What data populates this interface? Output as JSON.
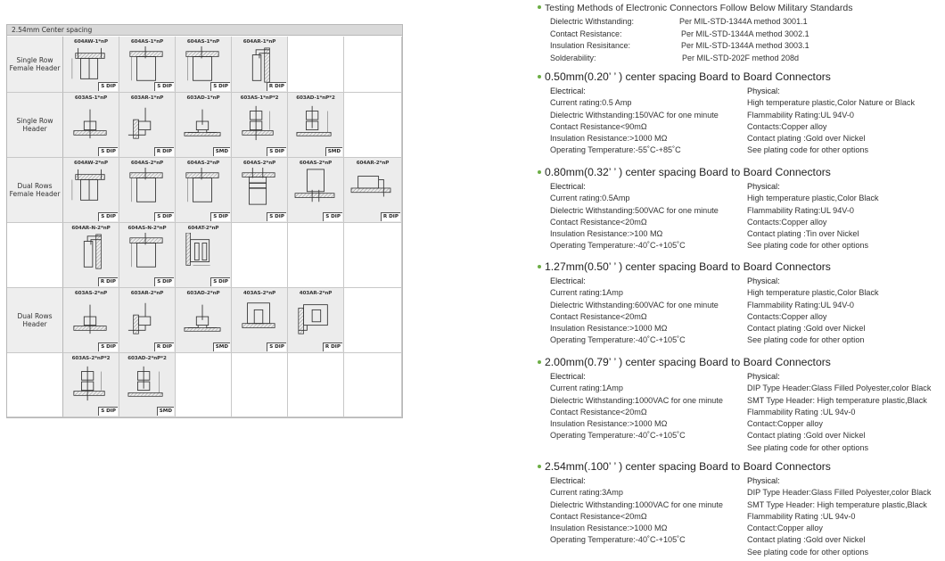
{
  "catalog": {
    "header": "2.54mm Center spacing",
    "rows": [
      {
        "label": "Single Row Female Header",
        "label_lines": [
          "Single Row",
          "Female Header"
        ],
        "cells": [
          {
            "part": "604AW-1*nP",
            "type": "S DIP",
            "icon": "female-header-wide-drawing"
          },
          {
            "part": "604AS-1*nP",
            "type": "S DIP",
            "icon": "female-header-straight-drawing"
          },
          {
            "part": "604AS-1*nP",
            "type": "S DIP",
            "icon": "female-header-straight-drawing"
          },
          {
            "part": "604AR-1*nP",
            "type": "R DIP",
            "icon": "female-header-right-angle-drawing"
          },
          null,
          null
        ]
      },
      {
        "label": "Single Row Header",
        "label_lines": [
          "Single Row",
          "Header"
        ],
        "cells": [
          {
            "part": "603AS-1*nP",
            "type": "S DIP",
            "icon": "pin-header-straight-drawing"
          },
          {
            "part": "603AR-1*nP",
            "type": "R DIP",
            "icon": "pin-header-right-angle-drawing"
          },
          {
            "part": "603AD-1*nP",
            "type": "SMD",
            "icon": "pin-header-smd-drawing"
          },
          {
            "part": "603AS-1*nP*2",
            "type": "S DIP",
            "icon": "pin-header-double-straight-drawing"
          },
          {
            "part": "603AD-1*nP*2",
            "type": "SMD",
            "icon": "pin-header-double-smd-drawing"
          },
          null
        ]
      },
      {
        "label": "Dual Rows Female Header",
        "label_lines": [
          "Dual Rows",
          "Female Header"
        ],
        "cells": [
          {
            "part": "604AW-2*nP",
            "type": "S DIP",
            "icon": "female-header-wide-drawing"
          },
          {
            "part": "604AS-2*nP",
            "type": "S DIP",
            "icon": "female-header-straight-drawing"
          },
          {
            "part": "604AS-2*nP",
            "type": "S DIP",
            "icon": "female-header-straight-drawing"
          },
          {
            "part": "604AS-2*nP",
            "type": "S DIP",
            "icon": "female-header-tall-drawing"
          },
          {
            "part": "604AS-2*nP",
            "type": "S DIP",
            "icon": "female-header-bottom-drawing"
          },
          {
            "part": "604AR-2*nP",
            "type": "R DIP",
            "icon": "female-header-right-angle-flat-drawing"
          }
        ]
      },
      {
        "label": "",
        "label_lines": [],
        "cells": [
          {
            "part": "604AR-N-2*nP",
            "type": "R DIP",
            "icon": "female-header-right-angle-drawing"
          },
          {
            "part": "604AS-N-2*nP",
            "type": "S DIP",
            "icon": "female-header-straight-drawing"
          },
          {
            "part": "604AT-2*nP",
            "type": "S DIP",
            "icon": "female-header-side-entry-drawing"
          },
          null,
          null,
          null
        ]
      },
      {
        "label": "Dual Rows Header",
        "label_lines": [
          "Dual Rows",
          "Header"
        ],
        "cells": [
          {
            "part": "603AS-2*nP",
            "type": "S DIP",
            "icon": "pin-header-straight-drawing"
          },
          {
            "part": "603AR-2*nP",
            "type": "R DIP",
            "icon": "pin-header-right-angle-drawing"
          },
          {
            "part": "603AD-2*nP",
            "type": "SMD",
            "icon": "pin-header-smd-drawing"
          },
          {
            "part": "403AS-2*nP",
            "type": "S DIP",
            "icon": "box-header-straight-drawing"
          },
          {
            "part": "403AR-2*nP",
            "type": "R DIP",
            "icon": "box-header-right-angle-drawing"
          },
          null
        ]
      },
      {
        "label": "",
        "label_lines": [],
        "cells": [
          {
            "part": "603AS-2*nP*2",
            "type": "S DIP",
            "icon": "pin-header-double-straight-drawing"
          },
          {
            "part": "603AD-2*nP*2",
            "type": "SMD",
            "icon": "pin-header-double-smd-drawing"
          },
          null,
          null,
          null,
          null
        ]
      }
    ]
  },
  "military": {
    "title": "Testing Methods of Electronic Connectors Follow Below Military Standards",
    "rows": [
      {
        "label": "Dielectric Withstanding:",
        "value": "Per MIL-STD-1344A method 3001.1"
      },
      {
        "label": "Contact  Resistance:",
        "value": "Per MIL-STD-1344A method 3002.1"
      },
      {
        "label": "Insulation Resisitance:",
        "value": "Per MIL-STD-1344A method 3003.1"
      },
      {
        "label": "Solderability:",
        "value": "Per MIL-STD-202F method 208d"
      }
    ]
  },
  "sections": [
    {
      "title": "0.50mm(0.20’ ’ ) center spacing Board to Board Connectors",
      "electrical_head": "Electrical:",
      "electrical": [
        "Current rating:0.5 Amp",
        "Dielectric Withstanding:150VAC for one minute",
        "Contact Resistance<90mΩ",
        "Insulation Resistance:>1000 MΩ",
        "Operating  Temperature:-55˚C-+85˚C"
      ],
      "physical_head": "Physical:",
      "physical": [
        "High temperature plastic,Color Nature or Black",
        "Flammability Rating:UL 94V-0",
        "Contacts:Copper alloy",
        "Contact plating :Gold over Nickel",
        "See plating code for other options"
      ]
    },
    {
      "title": "0.80mm(0.32’ ’ ) center spacing Board to Board Connectors",
      "electrical_head": "Electrical:",
      "electrical": [
        "Current rating:0.5Amp",
        "Dielectric Withstanding:500VAC for one minute",
        "Contact Resistance<20mΩ",
        "Insulation Resistance:>100 MΩ",
        "Operating  Temperature:-40˚C-+105˚C"
      ],
      "physical_head": "Physical:",
      "physical": [
        "High temperature plastic,Color Black",
        "Flammability Rating:UL 94V-0",
        "Contacts:Copper alloy",
        "Contact plating :Tin over Nickel",
        "See plating code for other options"
      ]
    },
    {
      "title": "1.27mm(0.50’ ’ ) center spacing Board to Board Connectors",
      "electrical_head": "Electrical:",
      "electrical": [
        "Current rating:1Amp",
        "Dielectric Withstanding:600VAC for one minute",
        "Contact Resistance<20mΩ",
        "Insulation Resistance:>1000 MΩ",
        "Operating  Temperature:-40˚C-+105˚C"
      ],
      "physical_head": "Physical:",
      "physical": [
        "High temperature plastic,Color Black",
        "Flammability Rating:UL 94V-0",
        "Contacts:Copper alloy",
        "Contact plating :Gold  over Nickel",
        "See plating code for other option"
      ]
    },
    {
      "title": "2.00mm(0.79’ ’ ) center spacing Board to Board Connectors",
      "electrical_head": "Electrical:",
      "electrical": [
        "Current rating:1Amp",
        "Dielectric Withstanding:1000VAC for one minute",
        "Contact Resistance<20mΩ",
        "Insulation Resistance:>1000 MΩ",
        "Operating  Temperature:-40˚C-+105˚C"
      ],
      "physical_head": "Physical:",
      "physical": [
        "DIP Type Header:Glass Filled Polyester,color Black",
        "SMT Type Header: High temperature plastic,Black",
        "Flammability Rating :UL 94v-0",
        "Contact:Copper alloy",
        "Contact plating :Gold over Nickel",
        "See plating code for other options"
      ]
    },
    {
      "title": "2.54mm(.100’ ’ ) center spacing Board to Board Connectors",
      "electrical_head": "Electrical:",
      "electrical": [
        "Current rating:3Amp",
        "Dielectric Withstanding:1000VAC for one minute",
        "Contact Resistance<20mΩ",
        "Insulation Resistance:>1000 MΩ",
        "Operating  Temperature:-40˚C-+105˚C"
      ],
      "physical_head": "Physical:",
      "physical": [
        "DIP Type Header:Glass Filled Polyester,color Black",
        "SMT Type Header: High temperature plastic,Black",
        "Flammability Rating :UL 94v-0",
        "Contact:Copper alloy",
        "Contact plating :Gold over Nickel",
        "See plating code for other options"
      ]
    }
  ],
  "colors": {
    "bullet": "#6cae45",
    "table_header_bg": "#d9d9d9",
    "filled_cell_bg": "#ececec",
    "border": "#b8b8b8"
  }
}
